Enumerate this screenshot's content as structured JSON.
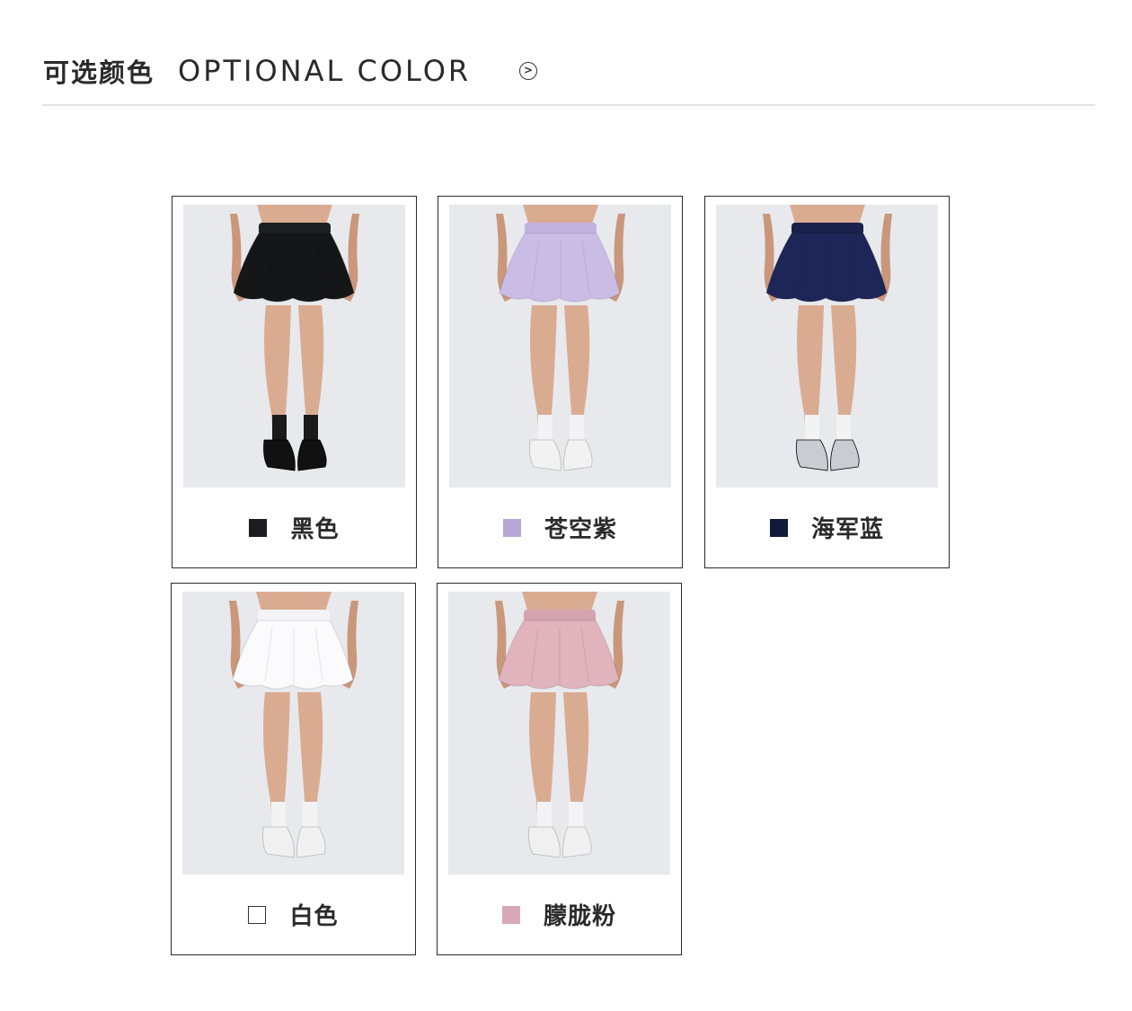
{
  "header": {
    "title_cn": "可选颜色",
    "title_en": "OPTIONAL COLOR",
    "icon": "chevron-right-circle-icon"
  },
  "colors": [
    {
      "name": "黑色",
      "swatch": "#1b1c20",
      "skirt": "#151618",
      "waist": "#1e1f22",
      "socks": "#1a1a1a",
      "shoes": "#111111"
    },
    {
      "name": "苍空紫",
      "swatch": "#b6a6d6",
      "skirt": "#c9bde6",
      "waist": "#c0b3e0",
      "socks": "#f3f3f3",
      "shoes": "#f2f2f2"
    },
    {
      "name": "海军蓝",
      "swatch": "#111a38",
      "skirt": "#1e2657",
      "waist": "#1a214a",
      "socks": "#f3f3f3",
      "shoes": "#c9ccd2"
    },
    {
      "name": "白色",
      "swatch": "#ffffff",
      "skirt": "#fbfbfd",
      "waist": "#f4f4f7",
      "socks": "#f3f3f3",
      "shoes": "#f0f0f0"
    },
    {
      "name": "朦胧粉",
      "swatch": "#d7a9b6",
      "skirt": "#e0b3bd",
      "waist": "#d5a3b0",
      "socks": "#f3f3f3",
      "shoes": "#f0f0f0"
    }
  ]
}
